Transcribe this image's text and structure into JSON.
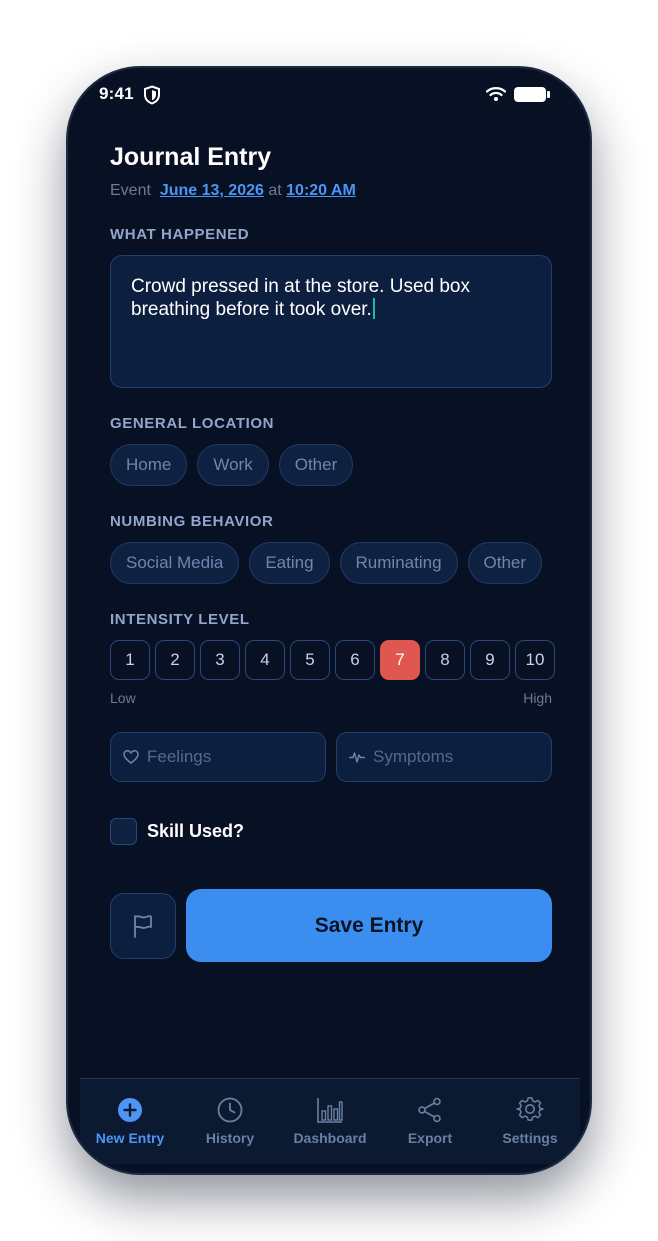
{
  "status_bar": {
    "time": "9:41"
  },
  "header": {
    "title": "Journal Entry",
    "event_prefix": "Event",
    "event_date": "June 13, 2026",
    "event_at": "at",
    "event_time": "10:20 AM"
  },
  "what_happened": {
    "label": "WHAT HAPPENED",
    "value": "Crowd pressed in at the store. Used box breathing before it took over."
  },
  "location": {
    "label": "GENERAL LOCATION",
    "options": [
      "Home",
      "Work",
      "Other"
    ]
  },
  "numbing": {
    "label": "NUMBING BEHAVIOR",
    "options": [
      "Social Media",
      "Eating",
      "Ruminating",
      "Other"
    ]
  },
  "intensity": {
    "label": "INTENSITY LEVEL",
    "levels": [
      "1",
      "2",
      "3",
      "4",
      "5",
      "6",
      "7",
      "8",
      "9",
      "10"
    ],
    "selected": "7",
    "low_label": "Low",
    "high_label": "High"
  },
  "fields": {
    "feelings_placeholder": "Feelings",
    "symptoms_placeholder": "Symptoms"
  },
  "skill": {
    "label": "Skill Used?",
    "checked": false
  },
  "actions": {
    "save_label": "Save Entry"
  },
  "tabs": [
    {
      "label": "New Entry",
      "icon": "plus-circle-icon",
      "active": true
    },
    {
      "label": "History",
      "icon": "clock-icon",
      "active": false
    },
    {
      "label": "Dashboard",
      "icon": "bar-chart-icon",
      "active": false
    },
    {
      "label": "Export",
      "icon": "share-icon",
      "active": false
    },
    {
      "label": "Settings",
      "icon": "gear-icon",
      "active": false
    }
  ],
  "colors": {
    "background": "#081024",
    "accent": "#3b8ef0",
    "selected_intensity": "#e05650",
    "link": "#4d94f5"
  }
}
